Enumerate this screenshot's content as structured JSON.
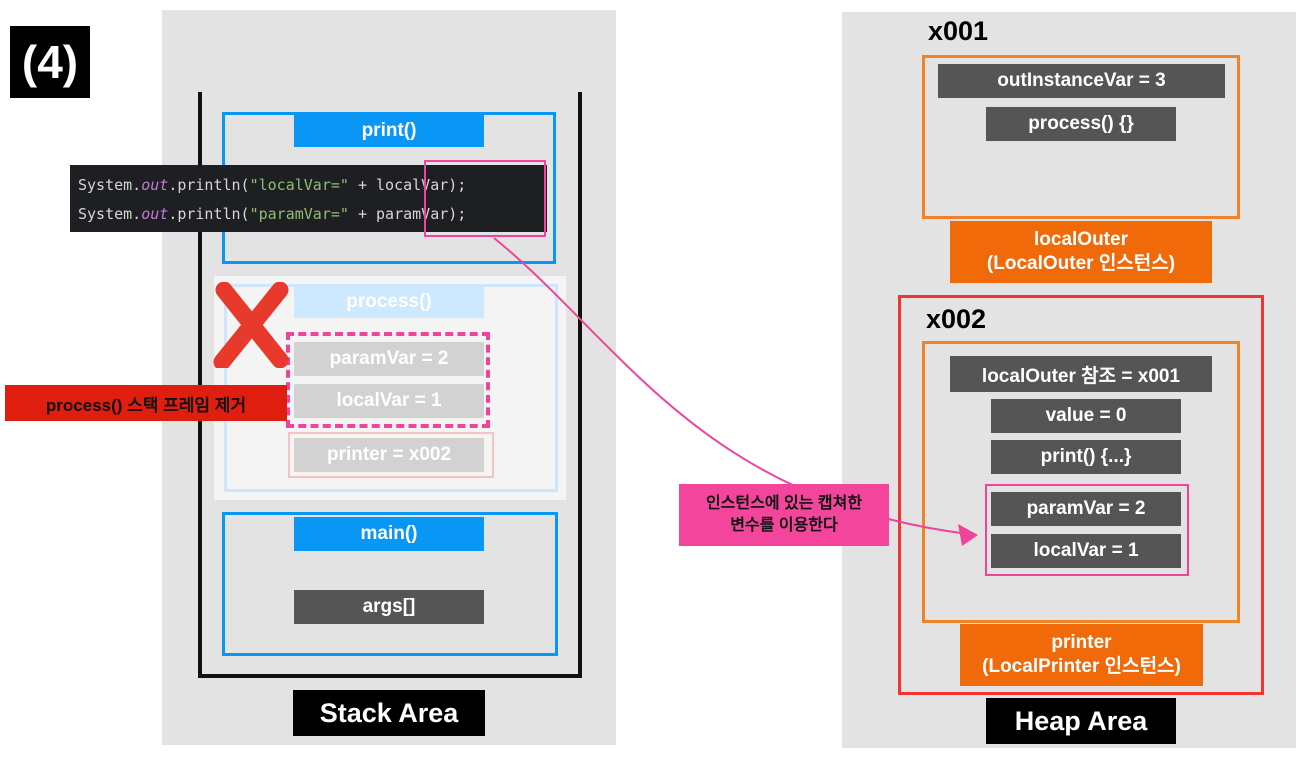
{
  "step_label": "(4)",
  "stack": {
    "area_label": "Stack Area",
    "print_frame": {
      "label": "print()"
    },
    "process_frame": {
      "label": "process()",
      "vars": [
        "paramVar = 2",
        "localVar = 1"
      ],
      "printer": "printer = x002",
      "removed_note": "process() 스택 프레임 제거"
    },
    "main_frame": {
      "label": "main()",
      "args": "args[]"
    },
    "code": {
      "line1": {
        "prefix": "System.",
        "out": "out",
        "mid": ".println(",
        "str": "\"localVar=\"",
        "op": " + ",
        "var": "localVar",
        "end": ");"
      },
      "line2": {
        "prefix": "System.",
        "out": "out",
        "mid": ".println(",
        "str": "\"paramVar=\"",
        "op": " + ",
        "var": "paramVar",
        "end": ");"
      }
    }
  },
  "heap": {
    "area_label": "Heap Area",
    "obj1": {
      "address": "x001",
      "fields": [
        "outInstanceVar = 3",
        "process() {}"
      ],
      "name_line1": "localOuter",
      "name_line2": "(LocalOuter 인스턴스)"
    },
    "obj2": {
      "address": "x002",
      "fields": [
        "localOuter 참조 = x001",
        "value = 0",
        "print() {...}"
      ],
      "captured": [
        "paramVar = 2",
        "localVar = 1"
      ],
      "name_line1": "printer",
      "name_line2": "(LocalPrinter 인스턴스)"
    }
  },
  "callout": {
    "line1": "인스턴스에 있는 캡쳐한",
    "line2": "변수를 이용한다"
  },
  "colors": {
    "stack_frame": "#0a96f5",
    "heap_object": "#f06a0a",
    "heap_outer_frame": "#f03434",
    "highlight": "#f0439b",
    "field": "#555555"
  }
}
